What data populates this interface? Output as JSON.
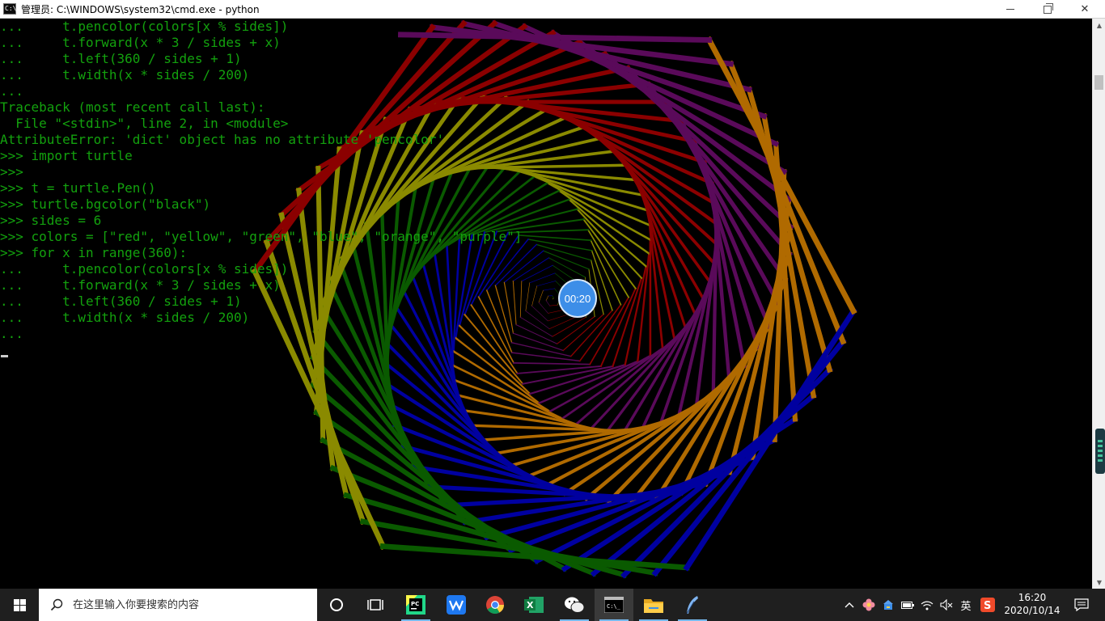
{
  "window": {
    "title": "管理员: C:\\WINDOWS\\system32\\cmd.exe - python",
    "minimize_icon": "minimize-icon",
    "maximize_icon": "restore-icon",
    "close_icon": "close-icon",
    "close_glyph": "✕"
  },
  "console": {
    "text_color": "#13a10e",
    "background": "#000000",
    "lines": [
      "...     t.pencolor(colors[x % sides])",
      "...     t.forward(x * 3 / sides + x)",
      "...     t.left(360 / sides + 1)",
      "...     t.width(x * sides / 200)",
      "...",
      "Traceback (most recent call last):",
      "  File \"<stdin>\", line 2, in <module>",
      "AttributeError: 'dict' object has no attribute 'pencolor'",
      ">>> import turtle",
      ">>>",
      ">>> t = turtle.Pen()",
      ">>> turtle.bgcolor(\"black\")",
      ">>> sides = 6",
      ">>> colors = [\"red\", \"yellow\", \"green\", \"blue\", \"orange\", \"purple\"]",
      ">>> for x in range(360):",
      "...     t.pencolor(colors[x % sides])",
      "...     t.forward(x * 3 / sides + x)",
      "...     t.left(360 / sides + 1)",
      "...     t.width(x * sides / 200)",
      "..."
    ]
  },
  "turtle_drawing": {
    "sides": 6,
    "colors": [
      "#8b0000",
      "#8a8a00",
      "#0a5a00",
      "#0000a0",
      "#b06a00",
      "#5a0a5a"
    ],
    "segments": 240
  },
  "timer": {
    "label": "00:20"
  },
  "taskbar": {
    "search_placeholder": "在这里输入你要搜索的内容",
    "apps": [
      {
        "name": "cortana-icon"
      },
      {
        "name": "task-view-icon"
      },
      {
        "name": "pycharm-icon"
      },
      {
        "name": "wps-icon"
      },
      {
        "name": "chrome-icon"
      },
      {
        "name": "excel-icon"
      },
      {
        "name": "wechat-icon"
      },
      {
        "name": "cmd-icon"
      },
      {
        "name": "file-explorer-icon"
      },
      {
        "name": "feather-icon"
      }
    ],
    "tray": {
      "ime_label": "英",
      "time": "16:20",
      "date": "2020/10/14"
    }
  }
}
